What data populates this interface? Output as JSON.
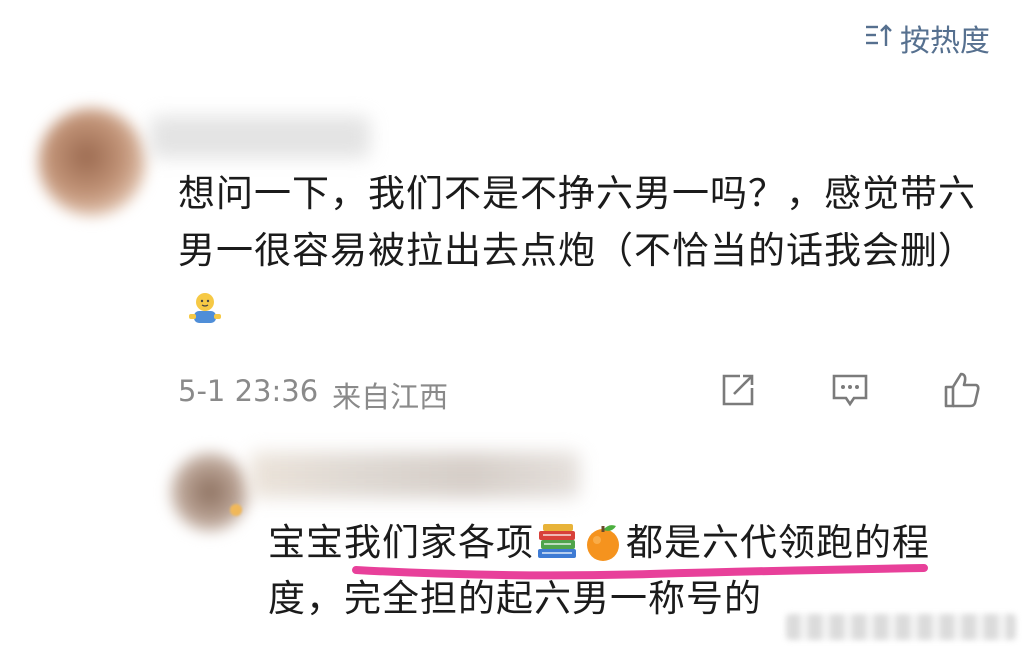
{
  "sort": {
    "label": "按热度",
    "icon": "sort-icon"
  },
  "comment": {
    "text": "想问一下，我们不是不挣六男一吗？，感觉带六男一很容易被拉出去点炮（不恰当的话我会删）",
    "emoji": "person-emoji",
    "time": "5-1 23:36",
    "location": "来自江西",
    "actions": [
      "share-icon",
      "comment-icon",
      "like-icon"
    ]
  },
  "reply": {
    "part1": "宝宝我们家各项",
    "part2": "都是六代领跑的程度，完全担的起六男一称号的",
    "emojis": [
      "books-emoji",
      "orange-emoji"
    ],
    "highlight_color": "#e8409a"
  },
  "colors": {
    "accent": "#56708f",
    "meta": "#8a8a8a",
    "text": "#1b1b1b"
  }
}
